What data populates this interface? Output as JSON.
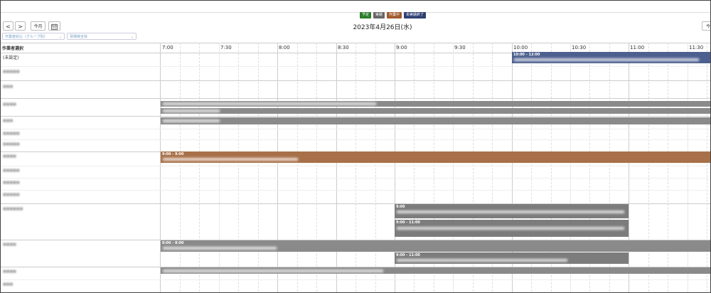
{
  "legend": [
    {
      "label": "予定",
      "color": "#2a7d2a"
    },
    {
      "label": "実績",
      "color": "#666666"
    },
    {
      "label": "作業中",
      "color": "#a05a2c"
    },
    {
      "label": "未実績終了",
      "color": "#2f3f73"
    }
  ],
  "toolbar": {
    "prev": "<",
    "next": ">",
    "today": "今月",
    "right": "今"
  },
  "date_title": "2023年4月26日(水)",
  "filters": {
    "group": "作業者絞込（グループ別）",
    "scope": "現場稼全体"
  },
  "header": {
    "worker_select": "作業者選択",
    "times": [
      "7:00",
      "7:30",
      "8:00",
      "8:30",
      "9:00",
      "9:30",
      "10:00",
      "10:30",
      "11:00",
      "11:30"
    ]
  },
  "rows": {
    "unassigned": "(未設定)"
  },
  "events": {
    "e1_time": "10:00 - 12:00",
    "e5_time": "9:00 - 9:00",
    "e6_time": "9:00",
    "e7_time": "9:00 - 11:00",
    "e8_time": "0:00 - 8:00",
    "e9_time": "9:00 - 11:00"
  },
  "colors": {
    "planned": "#4d5f8e",
    "actual": "#8a8a8a",
    "in_progress": "#a87048"
  }
}
